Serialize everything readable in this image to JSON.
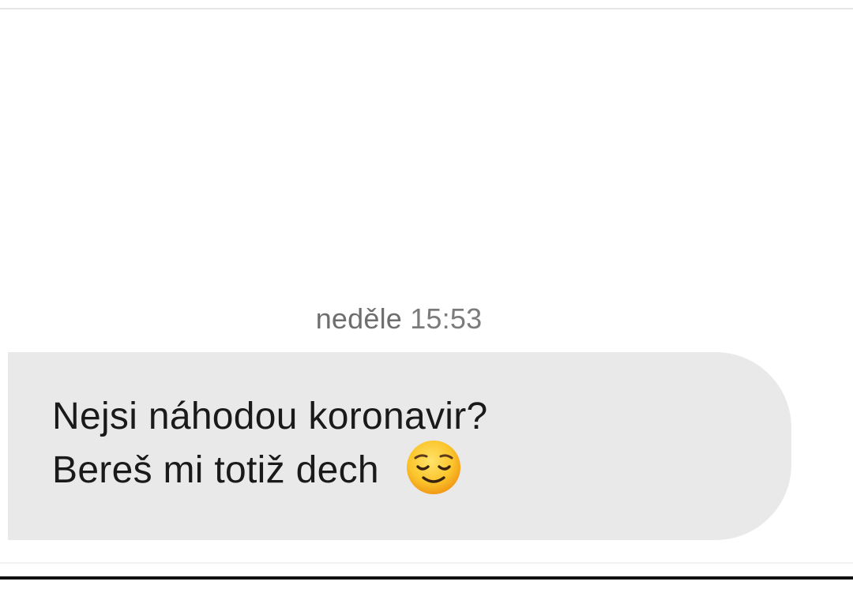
{
  "conversation": {
    "timestamp_day": "neděle",
    "timestamp_time": "15:53",
    "message": {
      "line1": "Nejsi náhodou koronavir?",
      "line2": "Bereš mi totiž dech",
      "emoji": "relieved-face-emoji",
      "bubble_color": "#e9e9e9",
      "text_color": "#1a1a1a"
    }
  }
}
